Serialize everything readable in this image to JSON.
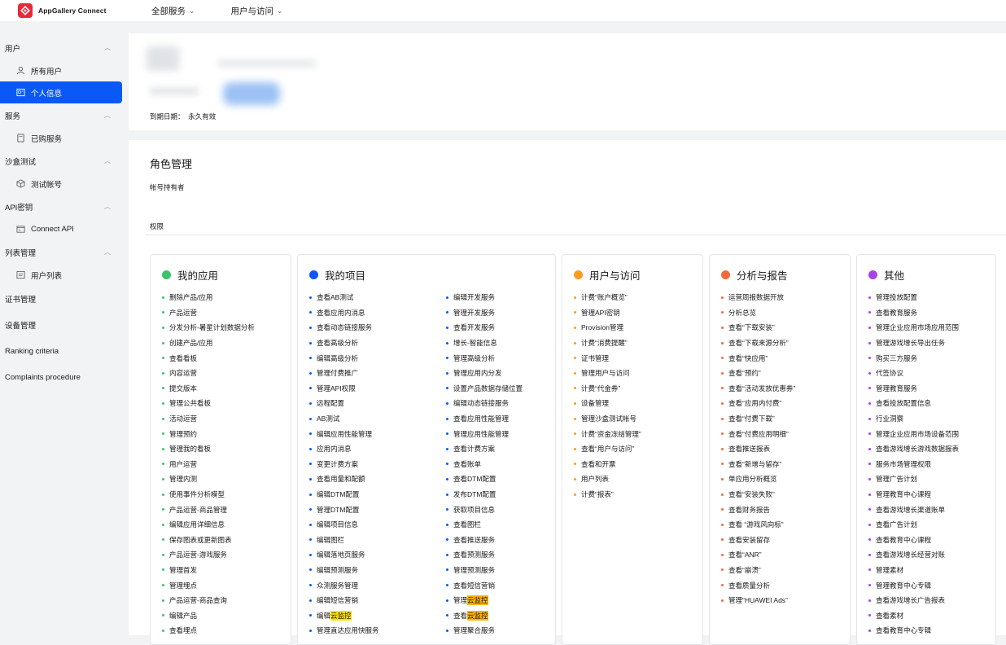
{
  "header": {
    "brand": "AppGallery Connect",
    "nav": [
      "全部服务",
      "用户与访问"
    ]
  },
  "sidebar": [
    {
      "type": "group",
      "label": "用户",
      "items": [
        {
          "icon": "user-icon",
          "label": "所有用户",
          "active": false
        },
        {
          "icon": "id-card-icon",
          "label": "个人信息",
          "active": true
        }
      ]
    },
    {
      "type": "group",
      "label": "服务",
      "items": [
        {
          "icon": "receipt-icon",
          "label": "已购服务",
          "active": false
        }
      ]
    },
    {
      "type": "group",
      "label": "沙盒测试",
      "items": [
        {
          "icon": "cube-icon",
          "label": "测试帐号",
          "active": false
        }
      ]
    },
    {
      "type": "group",
      "label": "API密钥",
      "items": [
        {
          "icon": "api-icon",
          "label": "Connect API",
          "active": false
        }
      ]
    },
    {
      "type": "group",
      "label": "列表管理",
      "items": [
        {
          "icon": "list-icon",
          "label": "用户列表",
          "active": false
        }
      ]
    },
    {
      "type": "plain",
      "label": "证书管理"
    },
    {
      "type": "plain",
      "label": "设备管理"
    },
    {
      "type": "plain",
      "label": "Ranking criteria"
    },
    {
      "type": "plain",
      "label": "Complaints procedure"
    }
  ],
  "profile": {
    "expire_label": "到期日期：",
    "expire_value": "永久有效"
  },
  "role": {
    "title": "角色管理",
    "value": "帐号持有者",
    "permissions_label": "权限"
  },
  "columns": [
    {
      "title": "我的应用",
      "color": "#3bc26b",
      "cols": 1,
      "items": [
        {
          "t": "删除产品/应用"
        },
        {
          "t": "产品运营"
        },
        {
          "t": "分发分析-暑星计划数据分析"
        },
        {
          "t": "创建产品/应用"
        },
        {
          "t": "查看看板"
        },
        {
          "t": "内容运营"
        },
        {
          "t": "提交版本"
        },
        {
          "t": "管理公共看板"
        },
        {
          "t": "活动运营"
        },
        {
          "t": "管理预约"
        },
        {
          "t": "管理我的看板"
        },
        {
          "t": "用户运营"
        },
        {
          "t": "管理内测"
        },
        {
          "t": "使用事件分析模型"
        },
        {
          "t": "产品运营-商品管理"
        },
        {
          "t": "编辑应用详细信息"
        },
        {
          "t": "保存图表或更新图表"
        },
        {
          "t": "产品运营-游戏服务"
        },
        {
          "t": "管理首发"
        },
        {
          "t": "管理埋点"
        },
        {
          "t": "产品运营-商品查询"
        },
        {
          "t": "编辑产品"
        },
        {
          "t": "查看埋点"
        }
      ]
    },
    {
      "title": "我的项目",
      "color": "#0a59f7",
      "cols": 2,
      "items": [
        {
          "t": "查看AB测试"
        },
        {
          "t": "编辑开发服务"
        },
        {
          "t": "查看应用内消息"
        },
        {
          "t": "管理开发服务"
        },
        {
          "t": "查看动态链接服务"
        },
        {
          "t": "查看开发服务"
        },
        {
          "t": "查看高级分析"
        },
        {
          "t": "增长-智能信息"
        },
        {
          "t": "编辑高级分析"
        },
        {
          "t": "管理高级分析"
        },
        {
          "t": "管理付费推广"
        },
        {
          "t": "管理应用内分发"
        },
        {
          "t": "管理API权限"
        },
        {
          "t": "设置产品数据存储位置"
        },
        {
          "t": "远程配置"
        },
        {
          "t": "编辑动态链接服务"
        },
        {
          "t": "AB测试"
        },
        {
          "t": "查看应用性能管理"
        },
        {
          "t": "编辑应用性能管理"
        },
        {
          "t": "管理应用性能管理"
        },
        {
          "t": "应用内消息"
        },
        {
          "t": "查看计费方案"
        },
        {
          "t": "变更计费方案"
        },
        {
          "t": "查看账单"
        },
        {
          "t": "查看用量和配额"
        },
        {
          "t": "查看DTM配置"
        },
        {
          "t": "编辑DTM配置"
        },
        {
          "t": "发布DTM配置"
        },
        {
          "t": "管理DTM配置"
        },
        {
          "t": "获取项目信息"
        },
        {
          "t": "编辑项目信息"
        },
        {
          "t": "查看图栏"
        },
        {
          "t": "编辑图栏"
        },
        {
          "t": "查看推送服务"
        },
        {
          "t": "编辑落地页服务"
        },
        {
          "t": "查看预测服务"
        },
        {
          "t": "编辑预测服务"
        },
        {
          "t": "管理预测服务"
        },
        {
          "t": "众测服务管理"
        },
        {
          "t": "查看短信营销"
        },
        {
          "t": "编辑短信营销"
        },
        {
          "t": "管理",
          "h": "云监控",
          "hc": "hl2"
        },
        {
          "t": "编辑",
          "h": "云监控",
          "hc": "hl"
        },
        {
          "t": "查看",
          "h": "云监控",
          "hc": "hl2"
        },
        {
          "t": "管理直达应用快服务"
        },
        {
          "t": "管理聚合服务"
        }
      ]
    },
    {
      "title": "用户与访问",
      "color": "#ff9a1f",
      "cols": 1,
      "items": [
        {
          "t": "计费“账户概览”"
        },
        {
          "t": "管理API密钥"
        },
        {
          "t": "Provision管理"
        },
        {
          "t": "计费“消费提醒”"
        },
        {
          "t": "证书管理"
        },
        {
          "t": "管理用户与访问"
        },
        {
          "t": "计费“代金券”"
        },
        {
          "t": "设备管理"
        },
        {
          "t": "管理沙盒测试帐号"
        },
        {
          "t": "计费“资金冻结管理”"
        },
        {
          "t": "查看“用户与访问”"
        },
        {
          "t": "查看和开票"
        },
        {
          "t": "用户列表"
        },
        {
          "t": "计费“报表”"
        }
      ]
    },
    {
      "title": "分析与报告",
      "color": "#f7693c",
      "cols": 1,
      "items": [
        {
          "t": "运营周报数据开放"
        },
        {
          "t": "分析总览"
        },
        {
          "t": "查看“下载安装”"
        },
        {
          "t": "查看“下载来源分析”"
        },
        {
          "t": "查看“快应用”"
        },
        {
          "t": "查看“预约”"
        },
        {
          "t": "查看“活动发放优惠券”"
        },
        {
          "t": "查看“应用内付费”"
        },
        {
          "t": "查看“付费下载”"
        },
        {
          "t": "查看“付费应用明细”"
        },
        {
          "t": "查看推送报表"
        },
        {
          "t": "查看“新增与留存”"
        },
        {
          "t": "单应用分析概览"
        },
        {
          "t": "查看“安装失败”"
        },
        {
          "t": "查看财务报告"
        },
        {
          "t": "查看 “游戏风向标”"
        },
        {
          "t": "查看安装留存"
        },
        {
          "t": "查看“ANR”"
        },
        {
          "t": "查看“崩溃”"
        },
        {
          "t": "查看质量分析"
        },
        {
          "t": "管理“HUAWEI Ads”"
        }
      ]
    },
    {
      "title": "其他",
      "color": "#a742e6",
      "cols": 1,
      "items": [
        {
          "t": "管理投放配置"
        },
        {
          "t": "查看教育服务"
        },
        {
          "t": "管理企业应用市场应用范围"
        },
        {
          "t": "管理游戏增长导出任务"
        },
        {
          "t": "购买三方服务"
        },
        {
          "t": "代签协议"
        },
        {
          "t": "管理教育服务"
        },
        {
          "t": "查看投放配置信息"
        },
        {
          "t": "行业洞察"
        },
        {
          "t": "管理企业应用市场设备范围"
        },
        {
          "t": "查看游戏增长游戏数据报表"
        },
        {
          "t": "服务市场管理权限"
        },
        {
          "t": "管理广告计划"
        },
        {
          "t": "管理教育中心课程"
        },
        {
          "t": "查看游戏增长渠道账单"
        },
        {
          "t": "查看广告计划"
        },
        {
          "t": "查看教育中心课程"
        },
        {
          "t": "查看游戏增长经营对账"
        },
        {
          "t": "管理素材"
        },
        {
          "t": "管理教育中心专辑"
        },
        {
          "t": "查看游戏增长广告报表"
        },
        {
          "t": "查看素材"
        },
        {
          "t": "查看教育中心专辑"
        }
      ]
    }
  ]
}
